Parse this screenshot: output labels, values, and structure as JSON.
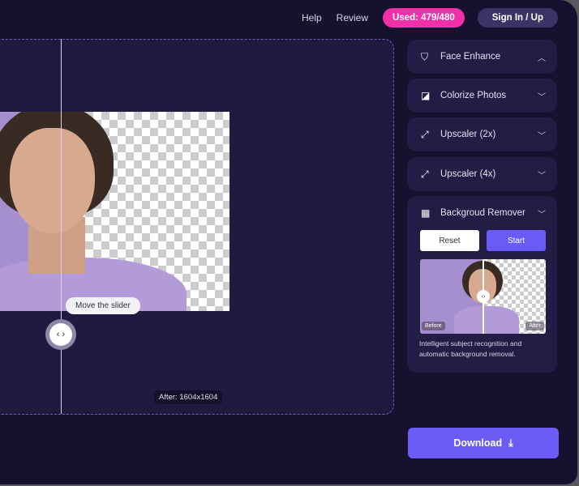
{
  "nav": {
    "help": "Help",
    "review": "Review",
    "used": "Used: 479/480",
    "sign_in": "Sign In / Up"
  },
  "canvas": {
    "tooltip": "Move the slider",
    "after_size": "After: 1604x1604",
    "slider_icon": "left-right-arrows-icon"
  },
  "tools": [
    {
      "label": "Face Enhance",
      "icon": "face-enhance-icon",
      "expanded": true
    },
    {
      "label": "Colorize Photos",
      "icon": "colorize-icon",
      "expanded": false
    },
    {
      "label": "Upscaler (2x)",
      "icon": "upscale-icon",
      "expanded": false
    },
    {
      "label": "Upscaler (4x)",
      "icon": "upscale-icon",
      "expanded": false
    },
    {
      "label": "Backgroud Remover",
      "icon": "checker-icon",
      "expanded": false
    }
  ],
  "bg_remover": {
    "reset": "Reset",
    "start": "Start",
    "before": "Before",
    "after": "After",
    "description": "Intelligent subject recognition and automatic background removal."
  },
  "download": "Download",
  "colors": {
    "accent": "#6c5cf5",
    "used_badge": "#f12fa8",
    "background": "#15112f",
    "card": "#211d45"
  }
}
